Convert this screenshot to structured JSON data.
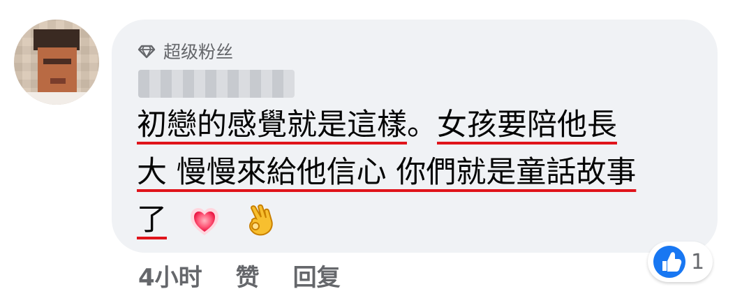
{
  "comment": {
    "badge": {
      "icon": "diamond-icon",
      "label": "超级粉丝"
    },
    "author_blurred": "Eddy Chang",
    "text_lines": [
      [
        "初戀的感覺就是這樣",
        "。",
        "女孩要陪他長"
      ],
      [
        "大 慢慢來給他信心 你們就是童話故事"
      ],
      [
        "了"
      ]
    ],
    "emojis": [
      "heart-icon",
      "ok-hand-icon"
    ],
    "meta": {
      "time": "4小时",
      "like_action": "赞",
      "reply_action": "回复"
    },
    "reactions": {
      "icon": "like-icon",
      "count": "1",
      "color": "#1877f2"
    }
  },
  "colors": {
    "bubble": "#f0f2f5",
    "secondary_text": "#65676b",
    "underline": "#e0141b"
  }
}
